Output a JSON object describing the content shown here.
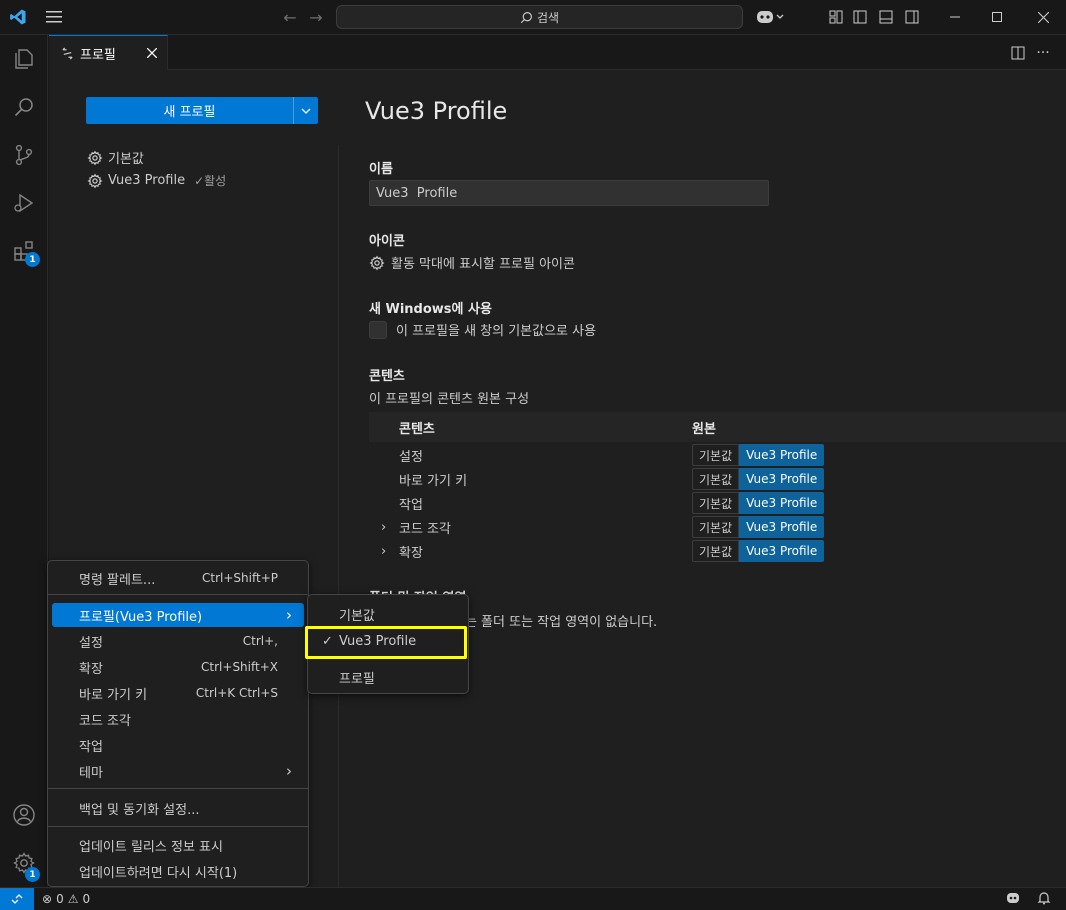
{
  "titlebar": {
    "search_placeholder": "검색"
  },
  "activity": {
    "extensions_badge": "1",
    "manage_badge": "1"
  },
  "tab": {
    "label": "프로필"
  },
  "profiles": {
    "new_button": "새 프로필",
    "items": [
      {
        "name": "기본값"
      },
      {
        "name": "Vue3 Profile",
        "active_label": "✓활성"
      }
    ]
  },
  "detail": {
    "title": "Vue3 Profile",
    "name_label": "이름",
    "name_value": "Vue3  Profile",
    "icon_label": "아이콘",
    "icon_desc": "활동 막대에 표시할 프로필 아이콘",
    "new_window_label": "새 Windows에 사용",
    "new_window_desc": "이 프로필을 새 창의 기본값으로 사용",
    "contents_label": "콘텐츠",
    "contents_desc": "이 프로필의 콘텐츠 원본 구성",
    "col_contents": "콘텐츠",
    "col_source": "원본",
    "rows": [
      {
        "name": "설정",
        "expandable": false
      },
      {
        "name": "바로 가기 키",
        "expandable": false
      },
      {
        "name": "작업",
        "expandable": false
      },
      {
        "name": "코드 조각",
        "expandable": true
      },
      {
        "name": "확장",
        "expandable": true
      }
    ],
    "source_default": "기본값",
    "source_profile": "Vue3 Profile",
    "folders_label": "폴더 및 작업 영역",
    "folders_desc": "하는 폴더 또는 작업 영역이 없습니다."
  },
  "menu": {
    "items": [
      {
        "label": "명령 팔레트...",
        "kb": "Ctrl+Shift+P"
      },
      {
        "label": "프로필(Vue3 Profile)",
        "kb": ""
      },
      {
        "label": "설정",
        "kb": "Ctrl+,"
      },
      {
        "label": "확장",
        "kb": "Ctrl+Shift+X"
      },
      {
        "label": "바로 가기 키",
        "kb": "Ctrl+K Ctrl+S"
      },
      {
        "label": "코드 조각",
        "kb": ""
      },
      {
        "label": "작업",
        "kb": ""
      },
      {
        "label": "테마",
        "kb": ""
      },
      {
        "label": "백업 및 동기화 설정...",
        "kb": ""
      },
      {
        "label": "업데이트 릴리스 정보 표시",
        "kb": ""
      },
      {
        "label": "업데이트하려면 다시 시작(1)",
        "kb": ""
      }
    ]
  },
  "submenu": {
    "items": [
      {
        "label": "기본값"
      },
      {
        "label": "Vue3 Profile"
      },
      {
        "label": "프로필"
      }
    ]
  },
  "status": {
    "errors": "0",
    "warnings": "0"
  }
}
